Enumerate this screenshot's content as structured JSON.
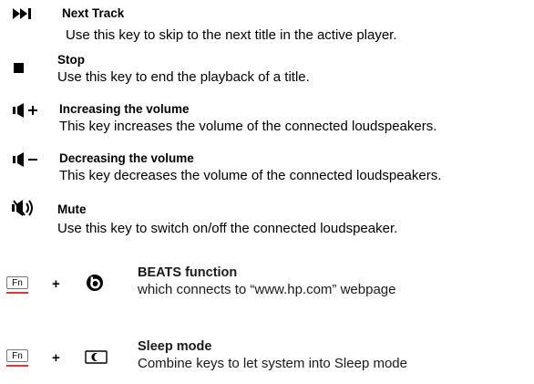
{
  "entries": [
    {
      "icon": "next-track-icon",
      "title": "Next Track",
      "description": "Use this key to skip to the next title in the active player."
    },
    {
      "icon": "stop-icon",
      "title": "Stop",
      "description": "Use this key to end the playback of a title."
    },
    {
      "icon": "volume-up-icon",
      "title": "Increasing the volume",
      "description": "This key increases the volume of the connected loudspeakers."
    },
    {
      "icon": "volume-down-icon",
      "title": "Decreasing the volume",
      "description": "This key decreases the volume of the connected loudspeakers."
    },
    {
      "icon": "mute-icon",
      "title": "Mute",
      "description": "Use this key to switch on/off the connected loudspeaker."
    }
  ],
  "combos": [
    {
      "key1": "Fn",
      "plus": "+",
      "icon": "beats-logo-icon",
      "title": "BEATS function",
      "description": "which connects to “www.hp.com” webpage"
    },
    {
      "key1": "Fn",
      "plus": "+",
      "icon": "sleep-moon-icon",
      "title": "Sleep mode",
      "description": "Combine keys to let system into Sleep mode"
    }
  ]
}
